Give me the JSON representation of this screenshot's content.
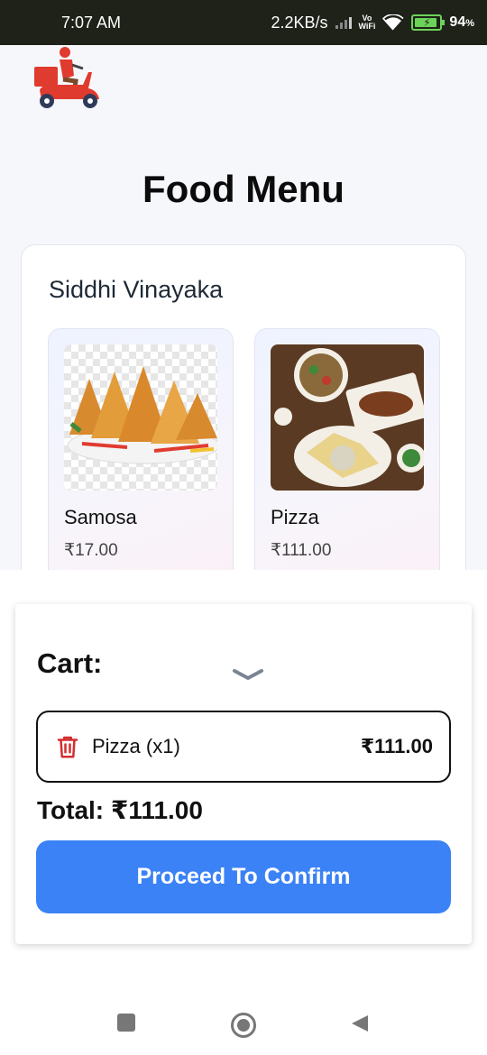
{
  "status_bar": {
    "time": "7:07 AM",
    "net_speed": "2.2KB/s",
    "vowifi_top": "Vo",
    "vowifi_bottom": "WiFi",
    "battery_percent": "94",
    "battery_unit": "%"
  },
  "header": {
    "logo_icon": "delivery-scooter-icon",
    "title": "Food Menu"
  },
  "restaurant": {
    "name": "Siddhi Vinayaka",
    "items": [
      {
        "name": "Samosa",
        "price": "₹17.00",
        "image": "samosa-image"
      },
      {
        "name": "Pizza",
        "price": "₹111.00",
        "image": "pizza-platter-image"
      }
    ]
  },
  "cart": {
    "title": "Cart:",
    "collapse_icon": "chevron-down-icon",
    "items": [
      {
        "label": "Pizza (x1)",
        "price": "₹111.00",
        "remove_icon": "trash-icon"
      }
    ],
    "total": "Total: ₹111.00",
    "confirm_label": "Proceed To Confirm",
    "accent_color": "#3b82f6"
  },
  "nav": {
    "recents_icon": "recents-square-icon",
    "home_icon": "home-circle-icon",
    "back_icon": "back-triangle-icon"
  }
}
